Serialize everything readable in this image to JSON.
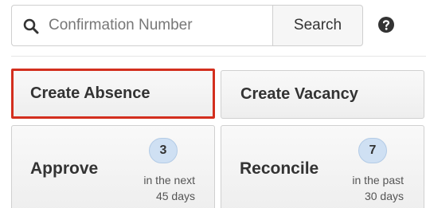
{
  "search": {
    "placeholder": "Confirmation Number",
    "button_label": "Search",
    "icon": "search-icon",
    "help_icon": "question-circle-icon"
  },
  "actions": {
    "create_absence": "Create Absence",
    "create_vacancy": "Create Vacancy",
    "highlight_color": "#d32f1e"
  },
  "cards": {
    "approve": {
      "title": "Approve",
      "count": "3",
      "caption_line1": "in the next",
      "caption_line2": "45 days"
    },
    "reconcile": {
      "title": "Reconcile",
      "count": "7",
      "caption_line1": "in the past",
      "caption_line2": "30 days"
    },
    "badge_color": "#cfe0f3"
  }
}
